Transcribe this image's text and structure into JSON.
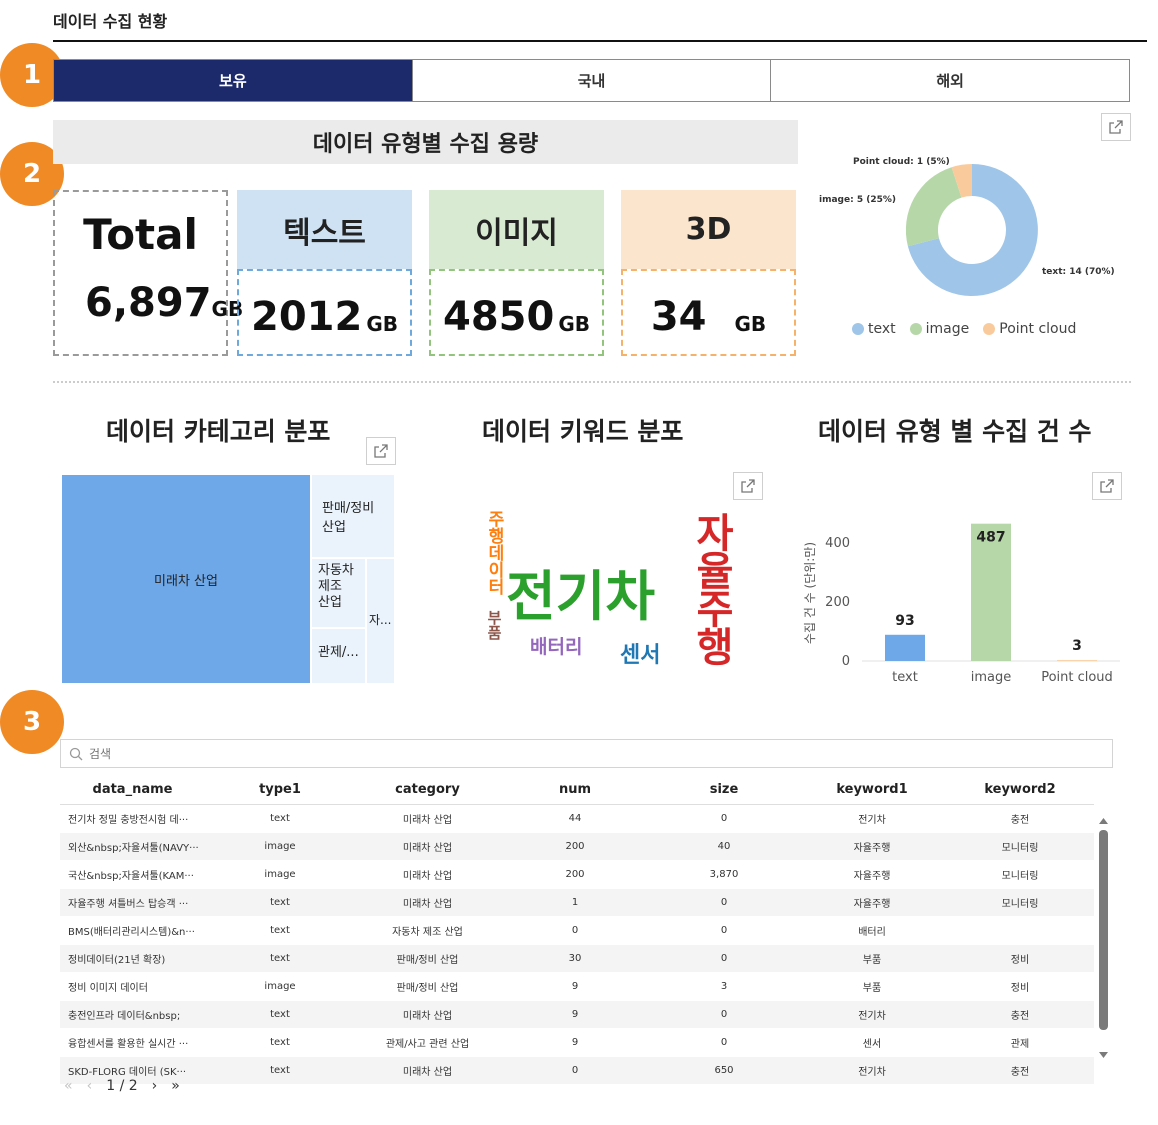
{
  "page": {
    "title": "데이터 수집 현황"
  },
  "badges": [
    "1",
    "2",
    "3"
  ],
  "tabs": [
    {
      "label": "보유",
      "active": true
    },
    {
      "label": "국내",
      "active": false
    },
    {
      "label": "해외",
      "active": false
    }
  ],
  "capacity": {
    "banner": "데이터 유형별 수집 용량",
    "total_label": "Total",
    "total_value": "6,897",
    "unit": "GB",
    "cards": [
      {
        "label": "텍스트",
        "value": "2012",
        "head_bg": "#cfe2f3",
        "border": "#6fa8dc"
      },
      {
        "label": "이미지",
        "value": "4850",
        "head_bg": "#d9ead3",
        "border": "#93c47d"
      },
      {
        "label": "3D",
        "value": "34",
        "head_bg": "#fce5cd",
        "border": "#f6b26b"
      }
    ]
  },
  "donut": {
    "labels": [
      "Point cloud: 1 (5%)",
      "image: 5 (25%)",
      "text: 14 (70%)"
    ],
    "legend": [
      {
        "label": "text",
        "color": "#9fc5e8"
      },
      {
        "label": "image",
        "color": "#b6d7a8"
      },
      {
        "label": "Point cloud",
        "color": "#f9cb9c"
      }
    ]
  },
  "category": {
    "title": "데이터 카테고리 분포",
    "blocks": {
      "main": "미래차 산업",
      "b1": "판매/정비\n산업",
      "b2": "자동차\n제조\n산업",
      "b3": "관제/...",
      "b4": "자..."
    },
    "colors": {
      "main": "#6fa8e8",
      "light": "#eaf3fc"
    }
  },
  "keywords": {
    "title": "데이터 키워드 분포",
    "words": [
      {
        "text": "전기차",
        "color": "#2ca02c"
      },
      {
        "text": "자율주행",
        "color": "#d62728"
      },
      {
        "text": "주행데이터",
        "color": "#ff7f0e"
      },
      {
        "text": "배터리",
        "color": "#9467bd"
      },
      {
        "text": "센서",
        "color": "#1f77b4"
      },
      {
        "text": "부품",
        "color": "#8c564b"
      }
    ]
  },
  "count_chart": {
    "title": "데이터 유형 별 수집 건 수"
  },
  "chart_data": {
    "type": "bar",
    "categories": [
      "text",
      "image",
      "Point cloud"
    ],
    "values": [
      93,
      487,
      3
    ],
    "colors": [
      "#6fa8e8",
      "#b6d7a8",
      "#f9cb9c"
    ],
    "ylabel": "수집 건 수 (단위:만)",
    "yticks": [
      "0",
      "200",
      "400"
    ],
    "ylim": [
      0,
      500
    ]
  },
  "search": {
    "placeholder": "검색"
  },
  "table": {
    "headers": [
      "data_name",
      "type1",
      "category",
      "num",
      "size",
      "keyword1",
      "keyword2"
    ],
    "rows": [
      [
        "전기차 정밀 충방전시험 데···",
        "text",
        "미래차 산업",
        "44",
        "0",
        "전기차",
        "충전"
      ],
      [
        "외산&nbsp;자율셔툴(NAVY···",
        "image",
        "미래차 산업",
        "200",
        "40",
        "자율주행",
        "모니터링"
      ],
      [
        "국산&nbsp;자율셔툴(KAM···",
        "image",
        "미래차 산업",
        "200",
        "3,870",
        "자율주행",
        "모니터링"
      ],
      [
        "자율주행 셔틀버스 탑승객 ···",
        "text",
        "미래차 산업",
        "1",
        "0",
        "자율주행",
        "모니터링"
      ],
      [
        "BMS(배터리관리시스템)&n···",
        "text",
        "자동차 제조 산업",
        "0",
        "0",
        "배터리",
        ""
      ],
      [
        "정비데이터(21년 확장)",
        "text",
        "판매/정비 산업",
        "30",
        "0",
        "부품",
        "정비"
      ],
      [
        "정비 이미지 데이터",
        "image",
        "판매/정비 산업",
        "9",
        "3",
        "부품",
        "정비"
      ],
      [
        "충전인프라 데이터&nbsp;",
        "text",
        "미래차 산업",
        "9",
        "0",
        "전기차",
        "충전"
      ],
      [
        "융합센서를 활용한 실시간 ···",
        "text",
        "관제/사고 관련 산업",
        "9",
        "0",
        "센서",
        "관제"
      ],
      [
        "SKD-FLORG 데이터 (SK···",
        "text",
        "미래차 산업",
        "0",
        "650",
        "전기차",
        "충전"
      ]
    ]
  },
  "pager": {
    "current": "1",
    "sep": "/",
    "total": "2"
  }
}
